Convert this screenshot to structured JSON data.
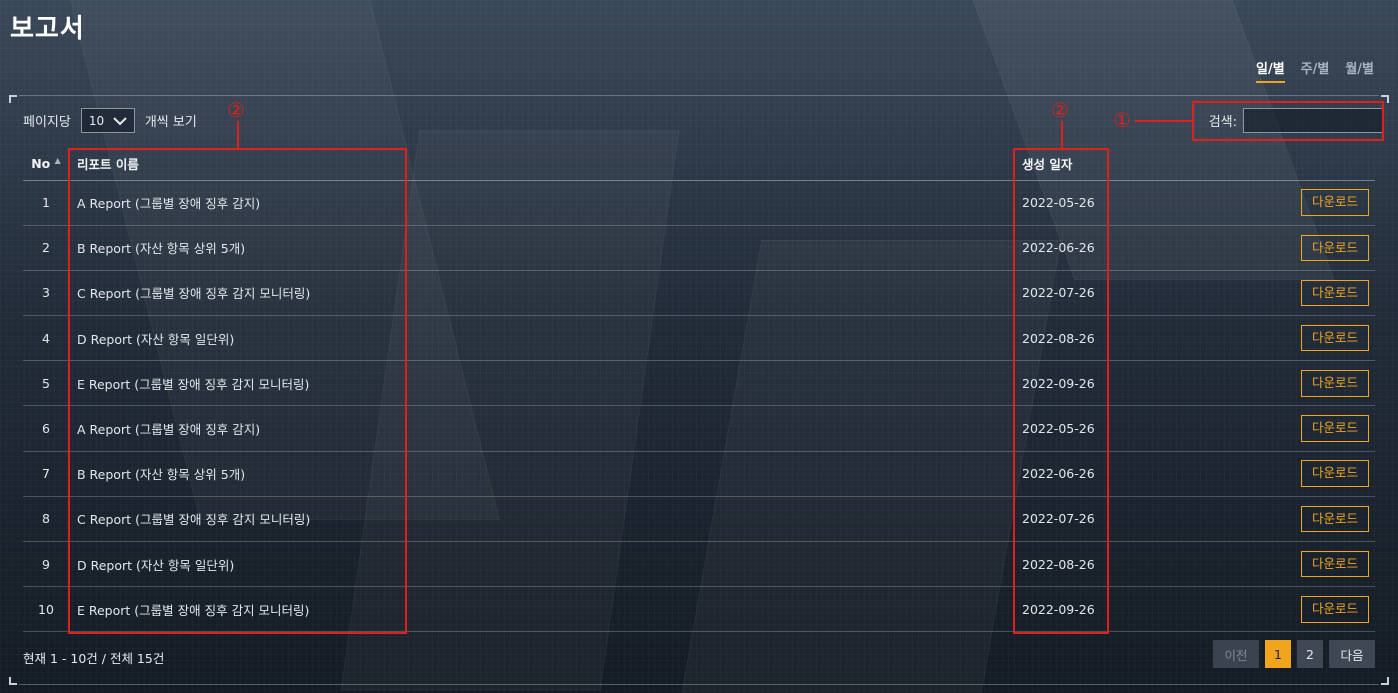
{
  "page": {
    "title": "보고서"
  },
  "period_tabs": [
    {
      "label": "일/별",
      "active": true
    },
    {
      "label": "주/별",
      "active": false
    },
    {
      "label": "월/별",
      "active": false
    }
  ],
  "length_control": {
    "prefix": "페이지당",
    "value": "10",
    "suffix": "개씩 보기"
  },
  "search": {
    "label": "검색:",
    "value": ""
  },
  "table": {
    "headers": {
      "no": "No",
      "name": "리포트 이름",
      "date": "생성 일자"
    },
    "download_label": "다운로드",
    "rows": [
      {
        "no": "1",
        "name": "A Report (그룹별 장애 징후 감지)",
        "date": "2022-05-26"
      },
      {
        "no": "2",
        "name": "B Report (자산 항목 상위 5개)",
        "date": "2022-06-26"
      },
      {
        "no": "3",
        "name": "C Report (그룹별 장애 징후 감지 모니터링)",
        "date": "2022-07-26"
      },
      {
        "no": "4",
        "name": "D Report (자산 항목 일단위)",
        "date": "2022-08-26"
      },
      {
        "no": "5",
        "name": "E Report (그룹별 장애 징후 감지 모니터링)",
        "date": "2022-09-26"
      },
      {
        "no": "6",
        "name": "A Report (그룹별 장애 징후 감지)",
        "date": "2022-05-26"
      },
      {
        "no": "7",
        "name": "B Report (자산 항목 상위 5개)",
        "date": "2022-06-26"
      },
      {
        "no": "8",
        "name": "C Report (그룹별 장애 징후 감지 모니터링)",
        "date": "2022-07-26"
      },
      {
        "no": "9",
        "name": "D Report (자산 항목 일단위)",
        "date": "2022-08-26"
      },
      {
        "no": "10",
        "name": "E Report (그룹별 장애 징후 감지 모니터링)",
        "date": "2022-09-26"
      }
    ]
  },
  "info_text": "현재 1 - 10건 / 전체 15건",
  "pagination": {
    "prev": "이전",
    "pages": [
      "1",
      "2"
    ],
    "active": "1",
    "next": "다음"
  },
  "annotations": {
    "search_marker": "①",
    "column_marker": "②",
    "color": "#e0201b"
  },
  "colors": {
    "accent": "#f0a51d",
    "annotation": "#e0201b"
  }
}
